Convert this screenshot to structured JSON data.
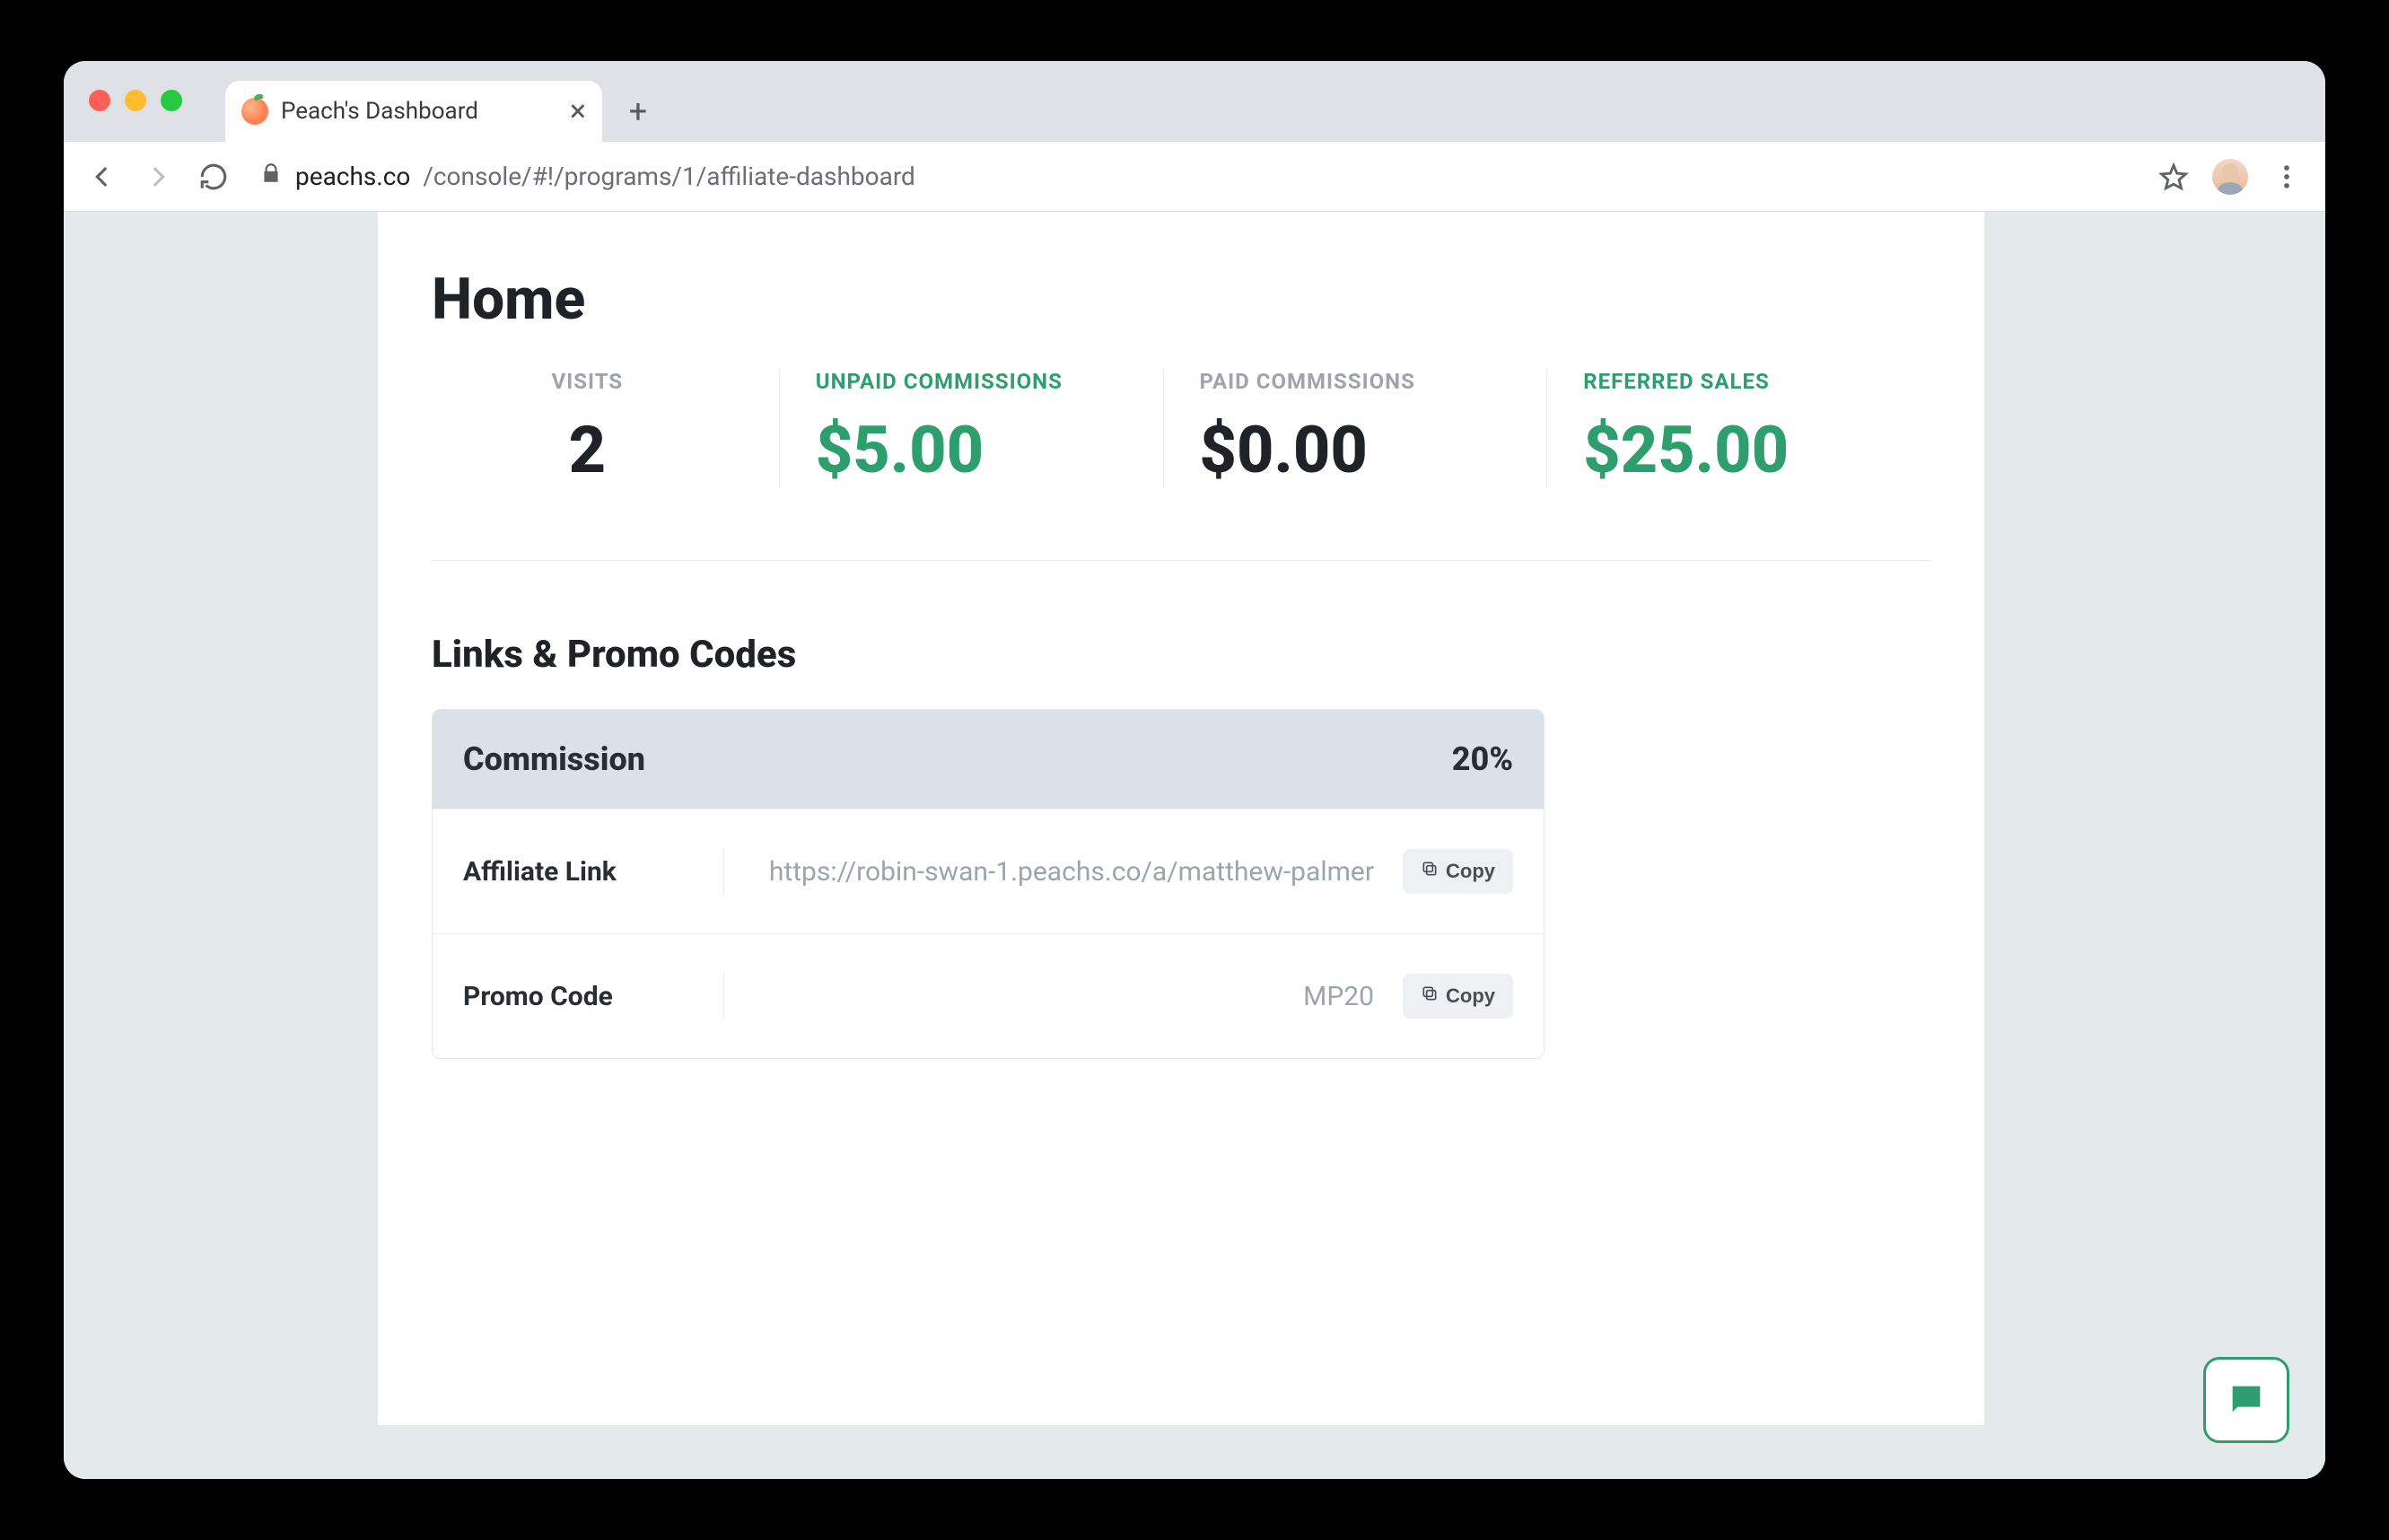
{
  "browser": {
    "tab_title": "Peach's Dashboard",
    "url_host": "peachs.co",
    "url_path": "/console/#!/programs/1/affiliate-dashboard"
  },
  "page": {
    "title": "Home",
    "stats": [
      {
        "label": "VISITS",
        "value": "2"
      },
      {
        "label": "UNPAID COMMISSIONS",
        "value": "$5.00"
      },
      {
        "label": "PAID COMMISSIONS",
        "value": "$0.00"
      },
      {
        "label": "REFERRED SALES",
        "value": "$25.00"
      }
    ],
    "links_section_title": "Links & Promo Codes",
    "commission_card": {
      "header_label": "Commission",
      "header_value": "20%",
      "affiliate_link_label": "Affiliate Link",
      "affiliate_link_value": "https://robin-swan-1.peachs.co/a/matthew-palmer",
      "promo_code_label": "Promo Code",
      "promo_code_value": "MP20",
      "copy_label": "Copy"
    }
  }
}
